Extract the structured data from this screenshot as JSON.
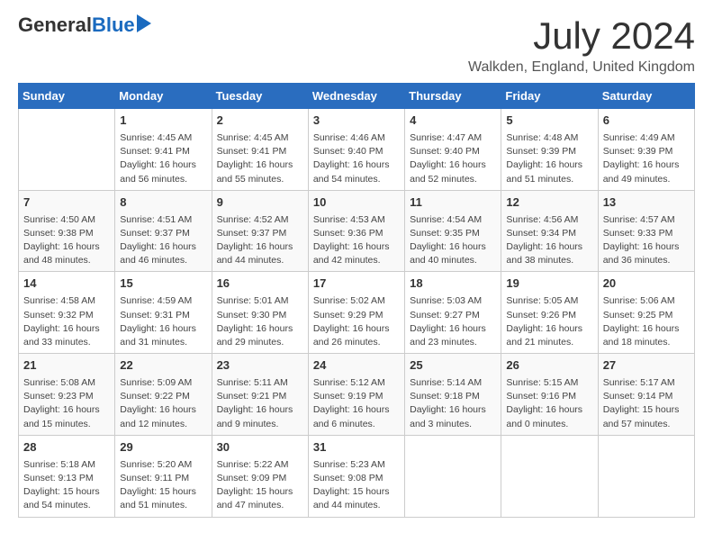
{
  "header": {
    "logo_general": "General",
    "logo_blue": "Blue",
    "month_title": "July 2024",
    "location": "Walkden, England, United Kingdom"
  },
  "days_of_week": [
    "Sunday",
    "Monday",
    "Tuesday",
    "Wednesday",
    "Thursday",
    "Friday",
    "Saturday"
  ],
  "weeks": [
    [
      {
        "day": "",
        "info": ""
      },
      {
        "day": "1",
        "info": "Sunrise: 4:45 AM\nSunset: 9:41 PM\nDaylight: 16 hours\nand 56 minutes."
      },
      {
        "day": "2",
        "info": "Sunrise: 4:45 AM\nSunset: 9:41 PM\nDaylight: 16 hours\nand 55 minutes."
      },
      {
        "day": "3",
        "info": "Sunrise: 4:46 AM\nSunset: 9:40 PM\nDaylight: 16 hours\nand 54 minutes."
      },
      {
        "day": "4",
        "info": "Sunrise: 4:47 AM\nSunset: 9:40 PM\nDaylight: 16 hours\nand 52 minutes."
      },
      {
        "day": "5",
        "info": "Sunrise: 4:48 AM\nSunset: 9:39 PM\nDaylight: 16 hours\nand 51 minutes."
      },
      {
        "day": "6",
        "info": "Sunrise: 4:49 AM\nSunset: 9:39 PM\nDaylight: 16 hours\nand 49 minutes."
      }
    ],
    [
      {
        "day": "7",
        "info": "Sunrise: 4:50 AM\nSunset: 9:38 PM\nDaylight: 16 hours\nand 48 minutes."
      },
      {
        "day": "8",
        "info": "Sunrise: 4:51 AM\nSunset: 9:37 PM\nDaylight: 16 hours\nand 46 minutes."
      },
      {
        "day": "9",
        "info": "Sunrise: 4:52 AM\nSunset: 9:37 PM\nDaylight: 16 hours\nand 44 minutes."
      },
      {
        "day": "10",
        "info": "Sunrise: 4:53 AM\nSunset: 9:36 PM\nDaylight: 16 hours\nand 42 minutes."
      },
      {
        "day": "11",
        "info": "Sunrise: 4:54 AM\nSunset: 9:35 PM\nDaylight: 16 hours\nand 40 minutes."
      },
      {
        "day": "12",
        "info": "Sunrise: 4:56 AM\nSunset: 9:34 PM\nDaylight: 16 hours\nand 38 minutes."
      },
      {
        "day": "13",
        "info": "Sunrise: 4:57 AM\nSunset: 9:33 PM\nDaylight: 16 hours\nand 36 minutes."
      }
    ],
    [
      {
        "day": "14",
        "info": "Sunrise: 4:58 AM\nSunset: 9:32 PM\nDaylight: 16 hours\nand 33 minutes."
      },
      {
        "day": "15",
        "info": "Sunrise: 4:59 AM\nSunset: 9:31 PM\nDaylight: 16 hours\nand 31 minutes."
      },
      {
        "day": "16",
        "info": "Sunrise: 5:01 AM\nSunset: 9:30 PM\nDaylight: 16 hours\nand 29 minutes."
      },
      {
        "day": "17",
        "info": "Sunrise: 5:02 AM\nSunset: 9:29 PM\nDaylight: 16 hours\nand 26 minutes."
      },
      {
        "day": "18",
        "info": "Sunrise: 5:03 AM\nSunset: 9:27 PM\nDaylight: 16 hours\nand 23 minutes."
      },
      {
        "day": "19",
        "info": "Sunrise: 5:05 AM\nSunset: 9:26 PM\nDaylight: 16 hours\nand 21 minutes."
      },
      {
        "day": "20",
        "info": "Sunrise: 5:06 AM\nSunset: 9:25 PM\nDaylight: 16 hours\nand 18 minutes."
      }
    ],
    [
      {
        "day": "21",
        "info": "Sunrise: 5:08 AM\nSunset: 9:23 PM\nDaylight: 16 hours\nand 15 minutes."
      },
      {
        "day": "22",
        "info": "Sunrise: 5:09 AM\nSunset: 9:22 PM\nDaylight: 16 hours\nand 12 minutes."
      },
      {
        "day": "23",
        "info": "Sunrise: 5:11 AM\nSunset: 9:21 PM\nDaylight: 16 hours\nand 9 minutes."
      },
      {
        "day": "24",
        "info": "Sunrise: 5:12 AM\nSunset: 9:19 PM\nDaylight: 16 hours\nand 6 minutes."
      },
      {
        "day": "25",
        "info": "Sunrise: 5:14 AM\nSunset: 9:18 PM\nDaylight: 16 hours\nand 3 minutes."
      },
      {
        "day": "26",
        "info": "Sunrise: 5:15 AM\nSunset: 9:16 PM\nDaylight: 16 hours\nand 0 minutes."
      },
      {
        "day": "27",
        "info": "Sunrise: 5:17 AM\nSunset: 9:14 PM\nDaylight: 15 hours\nand 57 minutes."
      }
    ],
    [
      {
        "day": "28",
        "info": "Sunrise: 5:18 AM\nSunset: 9:13 PM\nDaylight: 15 hours\nand 54 minutes."
      },
      {
        "day": "29",
        "info": "Sunrise: 5:20 AM\nSunset: 9:11 PM\nDaylight: 15 hours\nand 51 minutes."
      },
      {
        "day": "30",
        "info": "Sunrise: 5:22 AM\nSunset: 9:09 PM\nDaylight: 15 hours\nand 47 minutes."
      },
      {
        "day": "31",
        "info": "Sunrise: 5:23 AM\nSunset: 9:08 PM\nDaylight: 15 hours\nand 44 minutes."
      },
      {
        "day": "",
        "info": ""
      },
      {
        "day": "",
        "info": ""
      },
      {
        "day": "",
        "info": ""
      }
    ]
  ]
}
